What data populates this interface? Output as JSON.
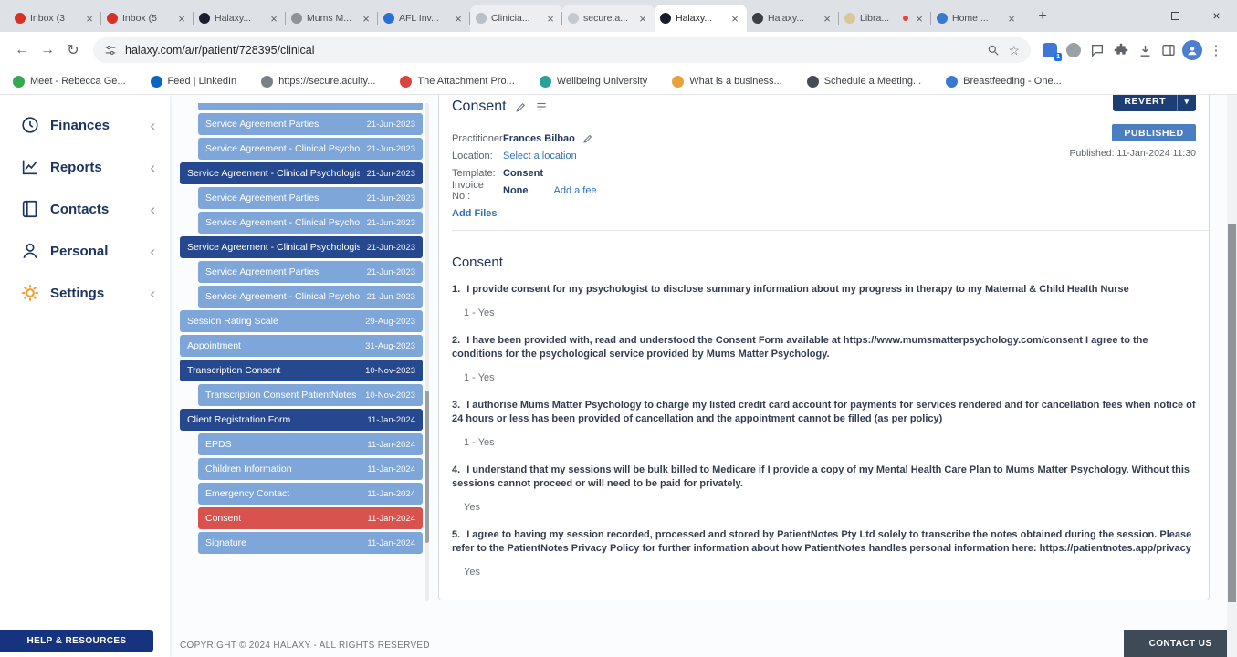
{
  "browser": {
    "tabs": [
      {
        "label": "Inbox (3",
        "icon": "gmail-icon",
        "color": "#d93025",
        "variant": ""
      },
      {
        "label": "Inbox (5",
        "icon": "gmail-icon",
        "color": "#d93025",
        "variant": ""
      },
      {
        "label": "Halaxy...",
        "icon": "halaxy-icon",
        "color": "#1a1d2e",
        "variant": ""
      },
      {
        "label": "Mums M...",
        "icon": "site-icon",
        "color": "#8e9398",
        "variant": ""
      },
      {
        "label": "AFL Inv...",
        "icon": "site-icon",
        "color": "#2a6fd6",
        "variant": ""
      },
      {
        "label": "Clinicia...",
        "icon": "site-icon",
        "color": "#b9bfc6",
        "variant": "pale"
      },
      {
        "label": "secure.a...",
        "icon": "site-icon",
        "color": "#c4c9cf",
        "variant": "pale"
      },
      {
        "label": "Halaxy...",
        "icon": "halaxy-icon",
        "color": "#1a1d2e",
        "variant": "active"
      },
      {
        "label": "Halaxy...",
        "icon": "halaxy-icon",
        "color": "#3a3f45",
        "variant": ""
      },
      {
        "label": "Libra...",
        "icon": "library-icon",
        "color": "#d8c79a",
        "variant": "has-dot"
      },
      {
        "label": "Home ...",
        "icon": "home-icon",
        "color": "#3b78d0",
        "variant": ""
      }
    ],
    "address": "halaxy.com/a/r/patient/728395/clinical",
    "bookmarks": [
      {
        "label": "Meet - Rebecca Ge...",
        "icon": "meet-icon",
        "color": "#34a853"
      },
      {
        "label": "Feed | LinkedIn",
        "icon": "linkedin-icon",
        "color": "#0a66c2"
      },
      {
        "label": "https://secure.acuity...",
        "icon": "globe-icon",
        "color": "#7a8087"
      },
      {
        "label": "The Attachment Pro...",
        "icon": "site-icon",
        "color": "#d64541"
      },
      {
        "label": "Wellbeing University",
        "icon": "site-icon",
        "color": "#2aa198"
      },
      {
        "label": "What is a business...",
        "icon": "site-icon",
        "color": "#e9a13b"
      },
      {
        "label": "Schedule a Meeting...",
        "icon": "calendar-icon",
        "color": "#474c52"
      },
      {
        "label": "Breastfeeding - One...",
        "icon": "site-icon",
        "color": "#3b78d0"
      }
    ]
  },
  "sidebar": {
    "items": [
      {
        "label": "Finances",
        "icon": "finances-icon"
      },
      {
        "label": "Reports",
        "icon": "reports-icon"
      },
      {
        "label": "Contacts",
        "icon": "contacts-icon"
      },
      {
        "label": "Personal",
        "icon": "personal-icon"
      },
      {
        "label": "Settings",
        "icon": "settings-icon"
      }
    ],
    "help_button": "HELP & RESOURCES"
  },
  "documents": [
    {
      "label": "Service Agreement Parties",
      "date": "21-Jun-2023",
      "variant": "blue indent"
    },
    {
      "label": "Service Agreement - Clinical Psychol...",
      "date": "21-Jun-2023",
      "variant": "blue indent"
    },
    {
      "label": "Service Agreement - Clinical Psychologist",
      "date": "21-Jun-2023",
      "variant": "dark"
    },
    {
      "label": "Service Agreement Parties",
      "date": "21-Jun-2023",
      "variant": "blue indent"
    },
    {
      "label": "Service Agreement - Clinical Psychol...",
      "date": "21-Jun-2023",
      "variant": "blue indent"
    },
    {
      "label": "Service Agreement - Clinical Psychologist",
      "date": "21-Jun-2023",
      "variant": "dark"
    },
    {
      "label": "Service Agreement Parties",
      "date": "21-Jun-2023",
      "variant": "blue indent"
    },
    {
      "label": "Service Agreement - Clinical Psychol...",
      "date": "21-Jun-2023",
      "variant": "blue indent"
    },
    {
      "label": "Session Rating Scale",
      "date": "29-Aug-2023",
      "variant": "blue"
    },
    {
      "label": "Appointment",
      "date": "31-Aug-2023",
      "variant": "blue"
    },
    {
      "label": "Transcription Consent",
      "date": "10-Nov-2023",
      "variant": "dark"
    },
    {
      "label": "Transcription Consent PatientNotes ...",
      "date": "10-Nov-2023",
      "variant": "blue indent"
    },
    {
      "label": "Client Registration Form",
      "date": "11-Jan-2024",
      "variant": "dark"
    },
    {
      "label": "EPDS",
      "date": "11-Jan-2024",
      "variant": "blue indent"
    },
    {
      "label": "Children Information",
      "date": "11-Jan-2024",
      "variant": "blue indent"
    },
    {
      "label": "Emergency Contact",
      "date": "11-Jan-2024",
      "variant": "blue indent"
    },
    {
      "label": "Consent",
      "date": "11-Jan-2024",
      "variant": "red indent"
    },
    {
      "label": "Signature",
      "date": "11-Jan-2024",
      "variant": "blue indent"
    }
  ],
  "detail": {
    "title": "Consent",
    "revert_button": "REVERT",
    "status_badge": "PUBLISHED",
    "published_line": "Published: 11-Jan-2024 11:30",
    "fields": {
      "practitioner_label": "Practitioner:",
      "practitioner_value": "Frances Bilbao",
      "location_label": "Location:",
      "location_link": "Select a location",
      "template_label": "Template:",
      "template_value": "Consent",
      "invoice_label": "Invoice No.:",
      "invoice_value": "None",
      "invoice_link": "Add a fee"
    },
    "add_files_link": "Add Files",
    "section_title": "Consent",
    "questions": [
      {
        "num": "1.",
        "text": "I provide consent for my psychologist to disclose summary information about my progress in therapy to my Maternal & Child Health Nurse",
        "answer": "1 - Yes"
      },
      {
        "num": "2.",
        "text": "I have been provided with, read and understood the Consent Form available at https://www.mumsmatterpsychology.com/consent I agree to the conditions for the psychological service provided by Mums Matter Psychology.",
        "answer": "1 - Yes"
      },
      {
        "num": "3.",
        "text": "I authorise Mums Matter Psychology to charge my listed credit card account for payments for services rendered and for cancellation fees when notice of 24 hours or less has been provided of cancellation and the appointment cannot be filled (as per policy)",
        "answer": "1 - Yes"
      },
      {
        "num": "4.",
        "text": "I understand that my sessions will be bulk billed to Medicare if I provide a copy of my Mental Health Care Plan to Mums Matter Psychology. Without this sessions cannot proceed or will need to be paid for privately.",
        "answer": "Yes"
      },
      {
        "num": "5.",
        "text": "I agree to having my session recorded, processed and stored by PatientNotes Pty Ltd solely to transcribe the notes obtained during the session. Please refer to the PatientNotes Privacy Policy for further information about how PatientNotes handles personal information here: https://patientnotes.app/privacy",
        "answer": "Yes"
      }
    ]
  },
  "footer": {
    "copyright": "COPYRIGHT © 2024 HALAXY - ALL RIGHTS RESERVED",
    "contact_button": "CONTACT US"
  },
  "colors": {
    "doc_blue": "#7ea6d8",
    "doc_dark": "#26488e",
    "doc_selected_red": "#d8534e",
    "accent_navy": "#16337f",
    "published_badge": "#4a7ec1",
    "revert_button": "#1c3e74",
    "link_blue": "#2f72b8"
  }
}
